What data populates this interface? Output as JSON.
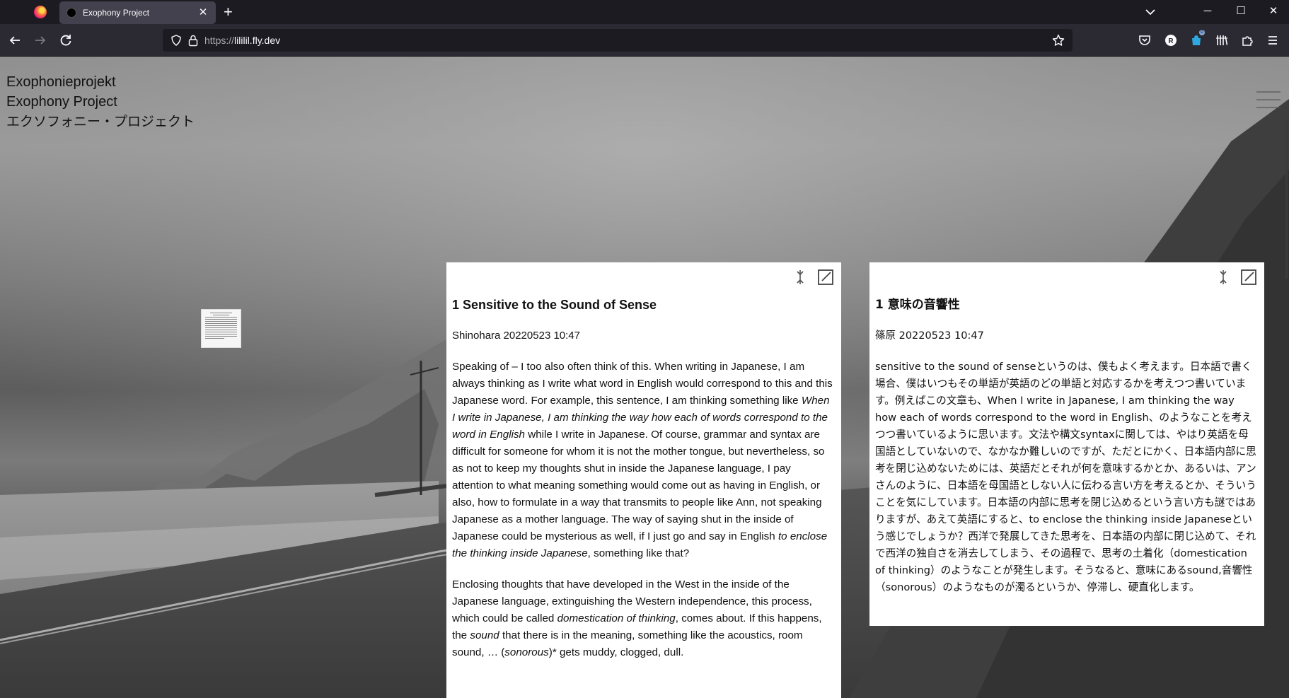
{
  "browser": {
    "tab_title": "Exophony Project",
    "url_scheme": "https://",
    "url_host": "lililil.fly.dev",
    "extension_badge": "0"
  },
  "site": {
    "title_de": "Exophonieprojekt",
    "title_en": "Exophony Project",
    "title_ja": "エクソフォニー・プロジェクト"
  },
  "cards": [
    {
      "title": "1 Sensitive to the Sound of Sense",
      "meta": "Shinohara 20220523 10:47",
      "paragraphs": [
        [
          {
            "t": "Speaking of – I too also often think of this. When writing in Japanese, I am always thinking as I write what word in English would correspond to this and this Japanese word. For example, this sentence, I am thinking something like "
          },
          {
            "t": "When I write in Japanese, I am thinking the way how each of words correspond to the word in English",
            "i": true
          },
          {
            "t": " while I write in Japanese. Of course, grammar and syntax are difficult for someone for whom it is not the mother tongue, but nevertheless, so as not to keep my thoughts shut in inside the Japanese language, I pay attention to what meaning something would come out as having in English, or also, how to formulate in a way that transmits to people like Ann, not speaking Japanese as a mother language. The way of saying shut in the inside of Japanese could be mysterious as well, if I just go and say in English "
          },
          {
            "t": "to enclose the thinking inside Japanese",
            "i": true
          },
          {
            "t": ", something like that?"
          }
        ],
        [
          {
            "t": "Enclosing thoughts that have developed in the West in the inside of the Japanese language, extinguishing the Western independence, this process, which could be called "
          },
          {
            "t": "domestication of thinking",
            "i": true
          },
          {
            "t": ", comes about. If this happens, the "
          },
          {
            "t": "sound",
            "i": true
          },
          {
            "t": " that there is in the meaning, something like the acoustics, room sound, … ("
          },
          {
            "t": "sonorous",
            "i": true
          },
          {
            "t": ")* gets muddy, clogged, dull."
          }
        ]
      ]
    },
    {
      "title": "1 意味の音響性",
      "meta": "篠原 20220523 10:47",
      "paragraphs": [
        [
          {
            "t": "sensitive to the sound of senseというのは、僕もよく考えます。日本語で書く場合、僕はいつもその単語が英語のどの単語と対応するかを考えつつ書いています。例えばこの文章も、When I write in Japanese, I am thinking the way how each of words correspond to the word in English、のようなことを考えつつ書いているように思います。文法や構文syntaxに関しては、やはり英語を母国語としていないので、なかなか難しいのですが、ただとにかく、日本語内部に思考を閉じ込めないためには、英語だとそれが何を意味するかとか、あるいは、アンさんのように、日本語を母国語としない人に伝わる言い方を考えるとか、そういうことを気にしています。日本語の内部に思考を閉じ込めるという言い方も謎ではありますが、あえて英語にすると、to enclose the thinking inside Japaneseという感じでしょうか？西洋で発展してきた思考を、日本語の内部に閉じ込めて、それで西洋の独自さを消去してしまう、その過程で、思考の土着化（domestication of thinking）のようなことが発生します。そうなると、意味にあるsound,音響性（sonorous）のようなものが濁るというか、停滞し、硬直化します。"
          }
        ]
      ]
    }
  ]
}
